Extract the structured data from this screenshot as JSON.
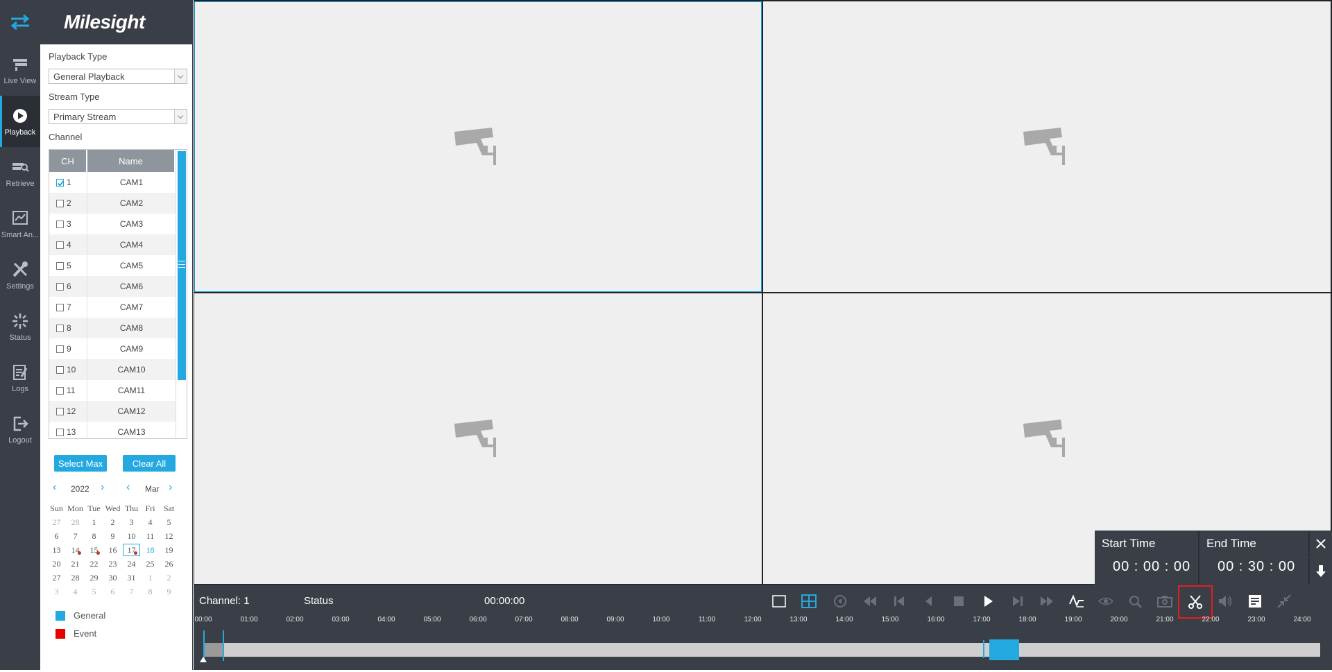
{
  "app": {
    "brand": "Milesight"
  },
  "nav": {
    "items": [
      {
        "label": "Live View",
        "icon": "live-view-icon"
      },
      {
        "label": "Playback",
        "icon": "playback-icon",
        "active": true
      },
      {
        "label": "Retrieve",
        "icon": "retrieve-icon"
      },
      {
        "label": "Smart An...",
        "icon": "smart-analysis-icon"
      },
      {
        "label": "Settings",
        "icon": "settings-icon"
      },
      {
        "label": "Status",
        "icon": "status-icon"
      },
      {
        "label": "Logs",
        "icon": "logs-icon"
      },
      {
        "label": "Logout",
        "icon": "logout-icon"
      }
    ]
  },
  "panel": {
    "playback_type_label": "Playback Type",
    "playback_type_value": "General Playback",
    "stream_type_label": "Stream Type",
    "stream_type_value": "Primary Stream",
    "channel_label": "Channel",
    "table_headers": {
      "ch": "CH",
      "name": "Name"
    },
    "channels": [
      {
        "no": "1",
        "name": "CAM1",
        "checked": true
      },
      {
        "no": "2",
        "name": "CAM2",
        "checked": false
      },
      {
        "no": "3",
        "name": "CAM3",
        "checked": false
      },
      {
        "no": "4",
        "name": "CAM4",
        "checked": false
      },
      {
        "no": "5",
        "name": "CAM5",
        "checked": false
      },
      {
        "no": "6",
        "name": "CAM6",
        "checked": false
      },
      {
        "no": "7",
        "name": "CAM7",
        "checked": false
      },
      {
        "no": "8",
        "name": "CAM8",
        "checked": false
      },
      {
        "no": "9",
        "name": "CAM9",
        "checked": false
      },
      {
        "no": "10",
        "name": "CAM10",
        "checked": false
      },
      {
        "no": "11",
        "name": "CAM11",
        "checked": false
      },
      {
        "no": "12",
        "name": "CAM12",
        "checked": false
      },
      {
        "no": "13",
        "name": "CAM13",
        "checked": false
      }
    ],
    "select_max_label": "Select Max",
    "clear_all_label": "Clear All",
    "calendar": {
      "year": "2022",
      "month": "Mar",
      "weekdays": [
        "Sun",
        "Mon",
        "Tue",
        "Wed",
        "Thu",
        "Fri",
        "Sat"
      ],
      "weeks": [
        [
          "27",
          "28",
          "1",
          "2",
          "3",
          "4",
          "5"
        ],
        [
          "6",
          "7",
          "8",
          "9",
          "10",
          "11",
          "12"
        ],
        [
          "13",
          "14",
          "15",
          "16",
          "17",
          "18",
          "19"
        ],
        [
          "20",
          "21",
          "22",
          "23",
          "24",
          "25",
          "26"
        ],
        [
          "27",
          "28",
          "29",
          "30",
          "31",
          "1",
          "2"
        ],
        [
          "3",
          "4",
          "5",
          "6",
          "7",
          "8",
          "9"
        ]
      ]
    },
    "legend": [
      {
        "label": "General",
        "color": "#23a8e0"
      },
      {
        "label": "Event",
        "color": "#e60000"
      }
    ]
  },
  "clip_window": {
    "start_title": "Start Time",
    "start_value": "00 : 00 : 00",
    "end_title": "End Time",
    "end_value": "00 : 30 : 00"
  },
  "bar": {
    "channel_text": "Channel: 1",
    "status_text": "Status",
    "time_text": "00:00:00",
    "ticks": [
      "00:00",
      "01:00",
      "02:00",
      "03:00",
      "04:00",
      "05:00",
      "06:00",
      "07:00",
      "08:00",
      "09:00",
      "10:00",
      "11:00",
      "12:00",
      "13:00",
      "14:00",
      "15:00",
      "16:00",
      "17:00",
      "18:00",
      "19:00",
      "20:00",
      "21:00",
      "22:00",
      "23:00",
      "24:00"
    ]
  },
  "colors": {
    "accent": "#23a8e0",
    "nav_bg": "#3a3f47",
    "event": "#e60000",
    "highlight_box": "#e02020"
  }
}
